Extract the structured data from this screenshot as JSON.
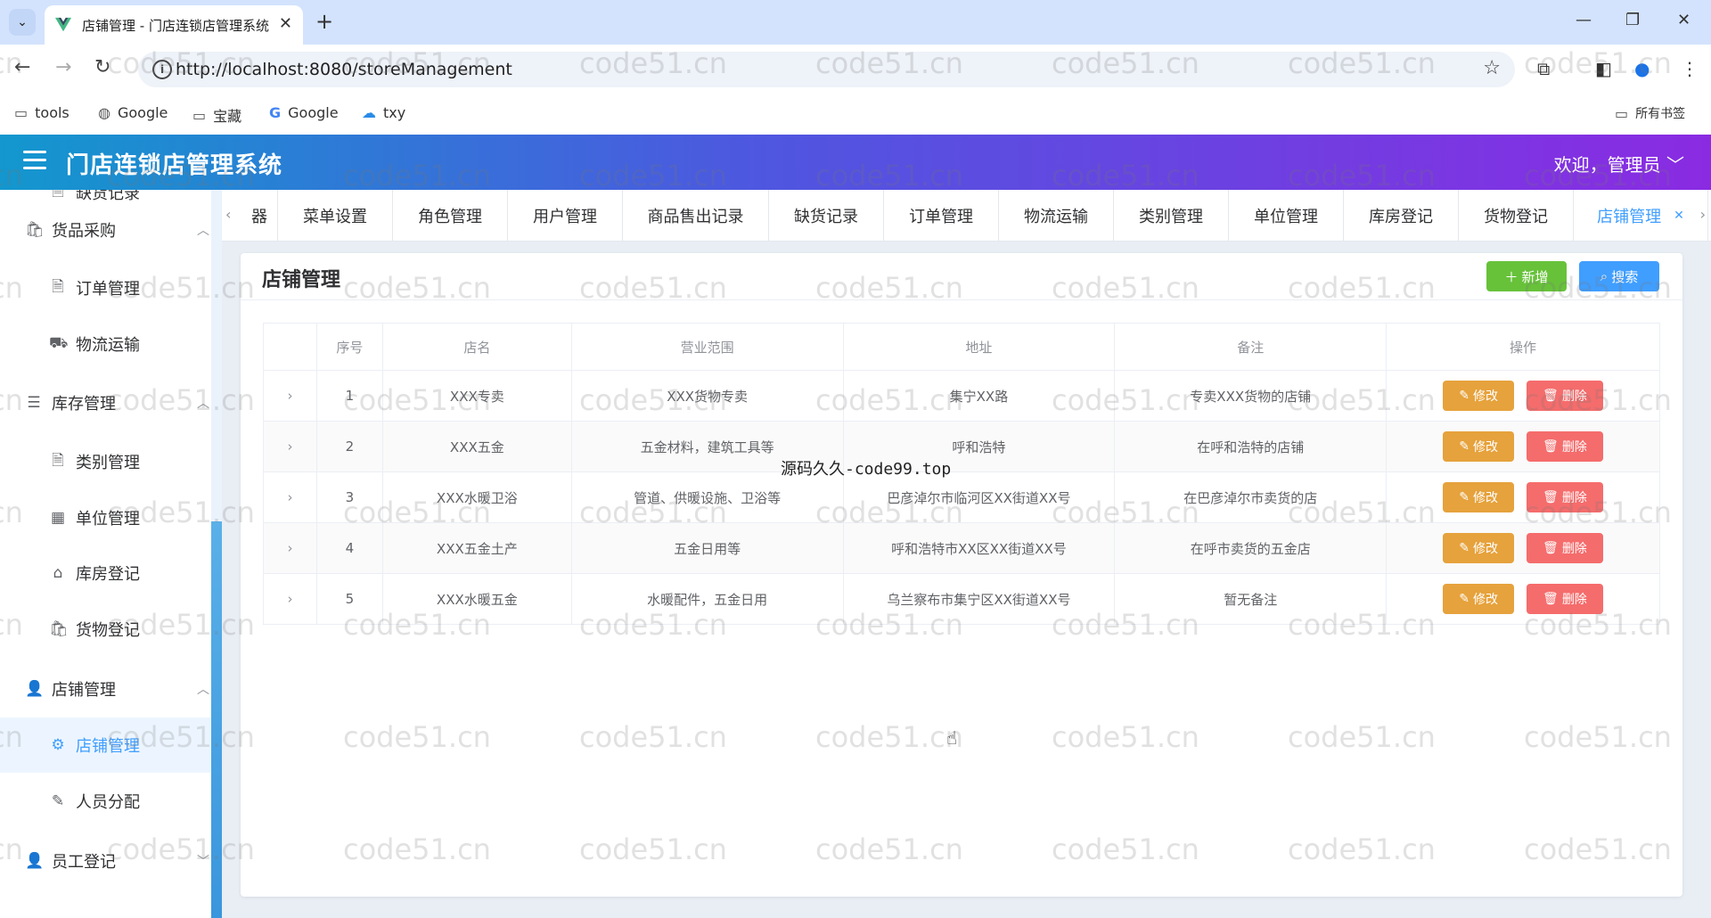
{
  "browser": {
    "tab_title": "店铺管理 - 门店连锁店管理系统",
    "tab_close": "✕",
    "new_tab": "+",
    "url": "http://localhost:8080/storeManagement",
    "bookmarks": [
      "tools",
      "Google",
      "宝藏",
      "Google",
      "txy"
    ],
    "all_bookmarks": "所有书签"
  },
  "header": {
    "title": "门店连锁店管理系统",
    "welcome": "欢迎，管理员"
  },
  "sidebar": {
    "items": [
      {
        "label": "缺货记录",
        "type": "sub",
        "icon": "doc-icon"
      },
      {
        "label": "货品采购",
        "type": "group",
        "icon": "bag-icon",
        "arrow": "︿"
      },
      {
        "label": "订单管理",
        "type": "sub",
        "icon": "doc-icon"
      },
      {
        "label": "物流运输",
        "type": "sub",
        "icon": "truck-icon"
      },
      {
        "label": "库存管理",
        "type": "group",
        "icon": "stack-icon",
        "arrow": "︿"
      },
      {
        "label": "类别管理",
        "type": "sub",
        "icon": "doc-icon"
      },
      {
        "label": "单位管理",
        "type": "sub",
        "icon": "building-icon"
      },
      {
        "label": "库房登记",
        "type": "sub",
        "icon": "house-icon"
      },
      {
        "label": "货物登记",
        "type": "sub",
        "icon": "bag-icon"
      },
      {
        "label": "店铺管理",
        "type": "group",
        "icon": "user-icon",
        "arrow": "︿"
      },
      {
        "label": "店铺管理",
        "type": "sub",
        "icon": "gear-icon",
        "active": true
      },
      {
        "label": "人员分配",
        "type": "sub",
        "icon": "edit-icon"
      },
      {
        "label": "员工登记",
        "type": "group",
        "icon": "user-icon",
        "arrow": "﹀"
      }
    ]
  },
  "tabs": [
    {
      "label": "器",
      "width": 40
    },
    {
      "label": "菜单设置",
      "width": 128
    },
    {
      "label": "角色管理",
      "width": 128
    },
    {
      "label": "用户管理",
      "width": 128
    },
    {
      "label": "商品售出记录",
      "width": 163
    },
    {
      "label": "缺货记录",
      "width": 128
    },
    {
      "label": "订单管理",
      "width": 128
    },
    {
      "label": "物流运输",
      "width": 128
    },
    {
      "label": "类别管理",
      "width": 128
    },
    {
      "label": "单位管理",
      "width": 128
    },
    {
      "label": "库房登记",
      "width": 128
    },
    {
      "label": "货物登记",
      "width": 128
    },
    {
      "label": "店铺管理",
      "width": 150,
      "active": true
    }
  ],
  "page": {
    "title": "店铺管理",
    "add_button": "新增",
    "search_button": "搜索"
  },
  "table": {
    "columns": [
      "",
      "序号",
      "店名",
      "营业范围",
      "地址",
      "备注",
      "操作"
    ],
    "edit_label": "修改",
    "delete_label": "删除",
    "rows": [
      {
        "index": "1",
        "name": "XXX专卖",
        "scope": "XXX货物专卖",
        "address": "集宁XX路",
        "remark": "专卖XXX货物的店铺"
      },
      {
        "index": "2",
        "name": "XXX五金",
        "scope": "五金材料，建筑工具等",
        "address": "呼和浩特",
        "remark": "在呼和浩特的店铺"
      },
      {
        "index": "3",
        "name": "XXX水暖卫浴",
        "scope": "管道、供暖设施、卫浴等",
        "address": "巴彦淖尔市临河区XX街道XX号",
        "remark": "在巴彦淖尔市卖货的店"
      },
      {
        "index": "4",
        "name": "XXX五金土产",
        "scope": "五金日用等",
        "address": "呼和浩特市XX区XX街道XX号",
        "remark": "在呼市卖货的五金店"
      },
      {
        "index": "5",
        "name": "XXX水暖五金",
        "scope": "水暖配件，五金日用",
        "address": "乌兰察布市集宁区XX街道XX号",
        "remark": "暂无备注"
      }
    ]
  },
  "watermark": "code51.cn",
  "center_watermark": "源码久久-code99.top",
  "colors": {
    "primary": "#409eff",
    "success": "#67c23a",
    "warning": "#e6a23c",
    "danger": "#f56c6c"
  }
}
